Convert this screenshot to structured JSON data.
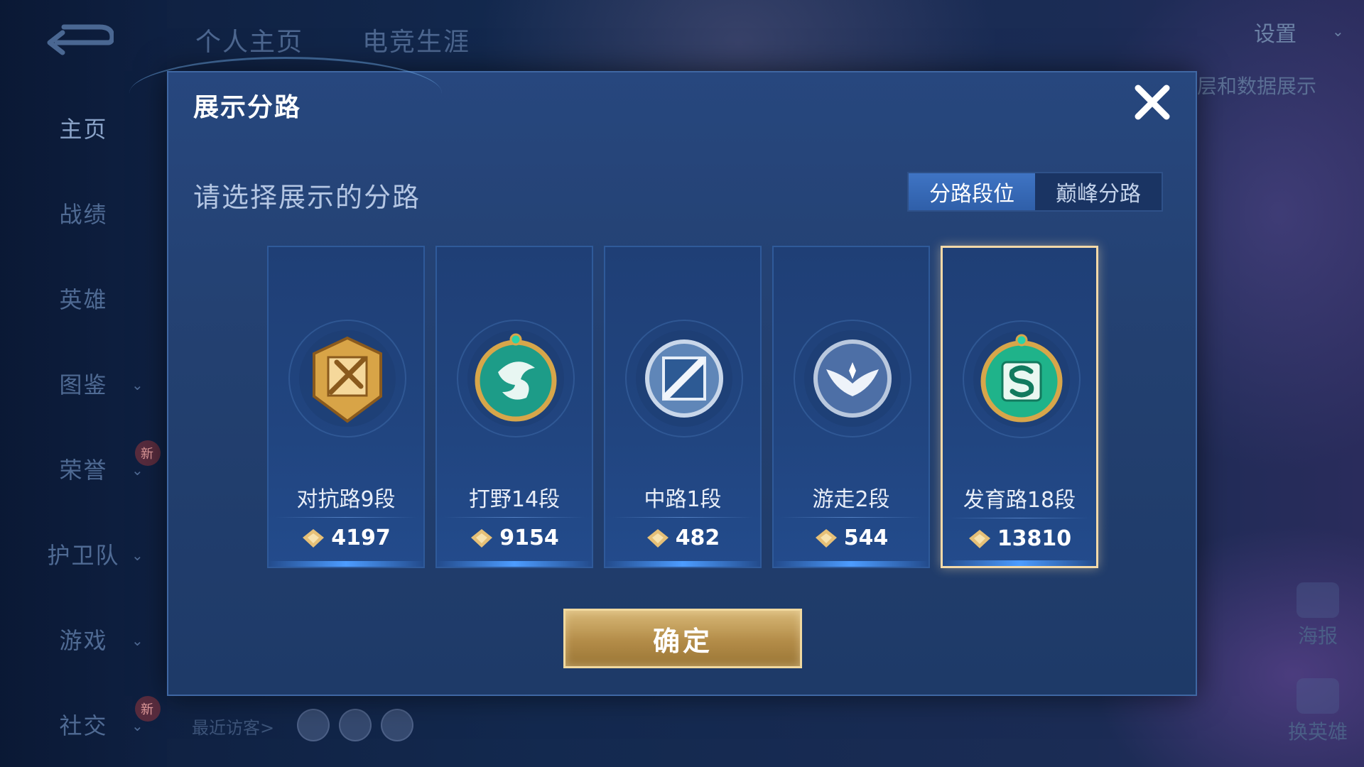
{
  "top_tabs": [
    "个人主页",
    "电竞生涯"
  ],
  "header": {
    "settings_label": "设置"
  },
  "sidebar": {
    "items": [
      {
        "label": "主页"
      },
      {
        "label": "战绩"
      },
      {
        "label": "英雄"
      },
      {
        "label": "图鉴"
      },
      {
        "label": "荣誉",
        "badge": "新"
      },
      {
        "label": "护卫队"
      },
      {
        "label": "游戏"
      },
      {
        "label": "社交",
        "badge": "新"
      }
    ]
  },
  "background": {
    "hint_text": "层和数据展示",
    "poster_label": "海报",
    "switch_hero_label": "换英雄",
    "recent_visitors_label": "最近访客>"
  },
  "dialog": {
    "title": "展示分路",
    "prompt": "请选择展示的分路",
    "toggle": [
      "分路段位",
      "巅峰分路"
    ],
    "active_toggle_index": 0,
    "cards": [
      {
        "lane": "对抗路9段",
        "score": "4197",
        "emblem": "top-lane-emblem-icon",
        "selected": false
      },
      {
        "lane": "打野14段",
        "score": "9154",
        "emblem": "jungle-dragon-emblem-icon",
        "selected": false
      },
      {
        "lane": "中路1段",
        "score": "482",
        "emblem": "mid-lane-emblem-icon",
        "selected": false
      },
      {
        "lane": "游走2段",
        "score": "544",
        "emblem": "roam-wings-emblem-icon",
        "selected": false
      },
      {
        "lane": "发育路18段",
        "score": "13810",
        "emblem": "farm-lane-emblem-icon",
        "selected": true
      }
    ],
    "confirm_label": "确定"
  },
  "colors": {
    "accent_gold": "#f3d9a8",
    "toggle_active": "#3f74c4",
    "dialog_bg": "#234070"
  }
}
